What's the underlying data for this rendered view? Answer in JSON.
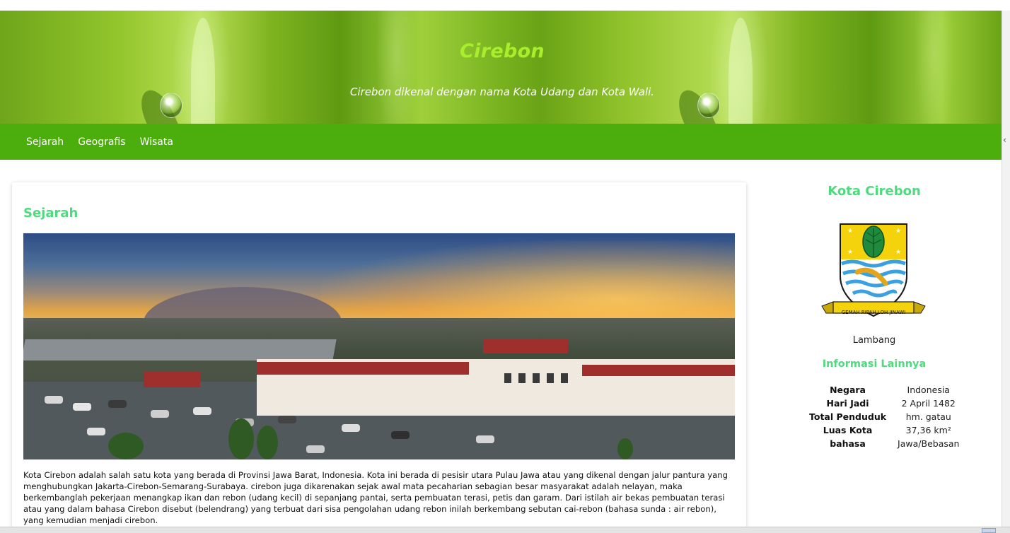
{
  "header": {
    "title": "Cirebon",
    "tagline": "Cirebon dikenal dengan nama Kota Udang dan Kota Wali."
  },
  "nav": {
    "items": [
      {
        "label": "Sejarah"
      },
      {
        "label": "Geografis"
      },
      {
        "label": "Wisata"
      }
    ]
  },
  "main": {
    "section_title": "Sejarah",
    "paragraph": "Kota Cirebon adalah salah satu kota yang berada di Provinsi Jawa Barat, Indonesia. Kota ini berada di pesisir utara Pulau Jawa atau yang dikenal dengan jalur pantura yang menghubungkan Jakarta-Cirebon-Semarang-Surabaya. cirebon juga dikarenakan sejak awal mata pecaharian sebagian besar masyarakat adalah nelayan, maka berkembanglah pekerjaan menangkap ikan dan rebon (udang kecil) di sepanjang pantai, serta pembuatan terasi, petis dan garam. Dari istilah air bekas pembuatan terasi atau yang dalam bahasa Cirebon disebut (belendrang) yang terbuat dari sisa pengolahan udang rebon inilah berkembang sebutan cai-rebon (bahasa sunda : air rebon), yang kemudian menjadi cirebon."
  },
  "sidebar": {
    "title": "Kota Cirebon",
    "emblem_motto": "GEMAH RIPAH LOH JINAWI",
    "emblem_caption": "Lambang",
    "info_title": "Informasi Lainnya",
    "info": [
      {
        "key": "Negara",
        "value": "Indonesia"
      },
      {
        "key": "Hari Jadi",
        "value": "2 April 1482"
      },
      {
        "key": "Total Penduduk",
        "value": "hm. gatau"
      },
      {
        "key": "Luas Kota",
        "value": "37,36 km²"
      },
      {
        "key": "bahasa",
        "value": "Jawa/Bebasan"
      }
    ]
  },
  "colors": {
    "nav_bg": "#4cae0c",
    "title_green": "#a8ee2c",
    "heading_green": "#4ddb7e"
  }
}
